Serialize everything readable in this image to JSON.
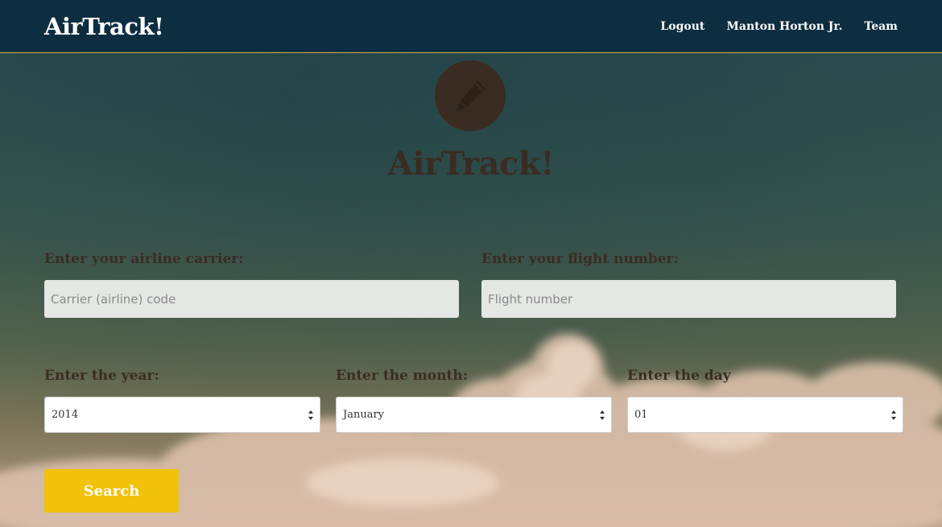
{
  "navbar": {
    "brand": "AirTrack!",
    "links": [
      "Logout",
      "Manton Horton Jr.",
      "Team"
    ]
  },
  "hero": {
    "icon": "pencil-icon",
    "title": "AirTrack!"
  },
  "form": {
    "carrier": {
      "label": "Enter your airline carrier:",
      "placeholder": "Carrier (airline) code",
      "value": ""
    },
    "flight": {
      "label": "Enter your flight number:",
      "placeholder": "Flight number",
      "value": ""
    },
    "year": {
      "label": "Enter the year:",
      "value": "2014"
    },
    "month": {
      "label": "Enter the month:",
      "value": "January"
    },
    "day": {
      "label": "Enter the day",
      "value": "01"
    },
    "search_label": "Search"
  },
  "colors": {
    "navbar": "#0d2e40",
    "accent": "#f0c20a",
    "text_dark": "#3a2c22",
    "input_bg": "#e4e7e4"
  }
}
